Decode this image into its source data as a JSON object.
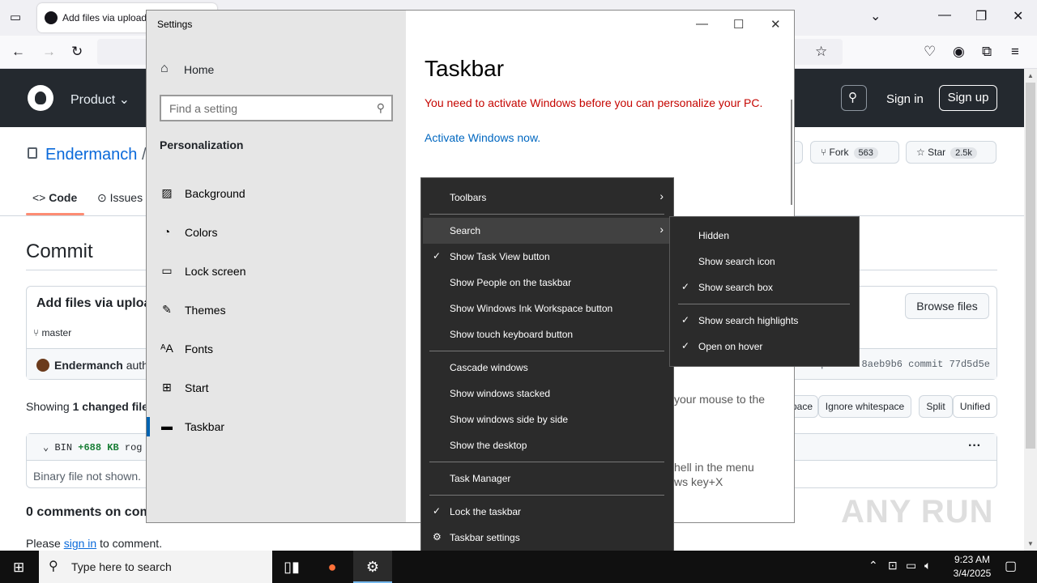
{
  "browser": {
    "tab_label": "Add files via upload",
    "window_controls": [
      "—",
      "❐",
      "✕"
    ]
  },
  "github": {
    "product_label": "Product",
    "signin_label": "Sign in",
    "signup_label": "Sign up",
    "repo_owner": "Endermanch",
    "repo_sep": "/",
    "fork_label": "Fork",
    "fork_count": "563",
    "star_label": "Star",
    "star_count": "2.5k",
    "tabs": {
      "code": "Code",
      "issues": "Issues"
    },
    "commit_title": "Commit",
    "commit_message": "Add files via uploa",
    "browse_files": "Browse files",
    "branch": "master",
    "author": "Endermanch",
    "author_suffix": "autho",
    "commit_hash": "1 parent 8aeb9b6   commit 77d5d5e",
    "showing_prefix": "Showing",
    "showing_bold": "1 changed file",
    "ignore_whitespace": "Ignore whitespace",
    "space_frag": "pace",
    "split": "Split",
    "unified": "Unified",
    "file_bin": "BIN",
    "file_size": "+688 KB",
    "file_name_frag": "rog",
    "file_note": "Binary file not shown.",
    "comments": "0 comments on com",
    "please": "Please",
    "signin_link": "sign in",
    "to_comment": "to comment.",
    "more_dots": "···"
  },
  "settings": {
    "window_title": "Settings",
    "home": "Home",
    "search_placeholder": "Find a setting",
    "section": "Personalization",
    "nav": [
      {
        "label": "Background",
        "icon": "image-icon"
      },
      {
        "label": "Colors",
        "icon": "palette-icon"
      },
      {
        "label": "Lock screen",
        "icon": "lock-screen-icon"
      },
      {
        "label": "Themes",
        "icon": "themes-icon"
      },
      {
        "label": "Fonts",
        "icon": "fonts-icon"
      },
      {
        "label": "Start",
        "icon": "start-icon"
      },
      {
        "label": "Taskbar",
        "icon": "taskbar-icon",
        "active": true
      }
    ],
    "page_title": "Taskbar",
    "warning": "You need to activate Windows before you can personalize your PC.",
    "activate_link": "Activate Windows now.",
    "frag1": "your mouse to the",
    "frag2": "hell in the menu",
    "frag3": "ws key+X"
  },
  "context_menu": {
    "items": [
      {
        "label": "Toolbars",
        "submenu": true
      },
      {
        "label": "Search",
        "submenu": true,
        "hover": true
      },
      {
        "label": "Show Task View button",
        "checked": true
      },
      {
        "label": "Show People on the taskbar"
      },
      {
        "label": "Show Windows Ink Workspace button"
      },
      {
        "label": "Show touch keyboard button"
      },
      {
        "label": "Cascade windows"
      },
      {
        "label": "Show windows stacked"
      },
      {
        "label": "Show windows side by side"
      },
      {
        "label": "Show the desktop"
      },
      {
        "label": "Task Manager"
      },
      {
        "label": "Lock the taskbar",
        "checked": true
      },
      {
        "label": "Taskbar settings",
        "gear": true
      }
    ]
  },
  "search_submenu": {
    "items": [
      {
        "label": "Hidden"
      },
      {
        "label": "Show search icon"
      },
      {
        "label": "Show search box",
        "checked": true
      },
      {
        "label": "Show search highlights",
        "checked": true
      },
      {
        "label": "Open on hover",
        "checked": true
      }
    ]
  },
  "watermark": "ANY RUN",
  "taskbar": {
    "search_placeholder": "Type here to search",
    "time": "9:23 AM",
    "date": "3/4/2025"
  }
}
